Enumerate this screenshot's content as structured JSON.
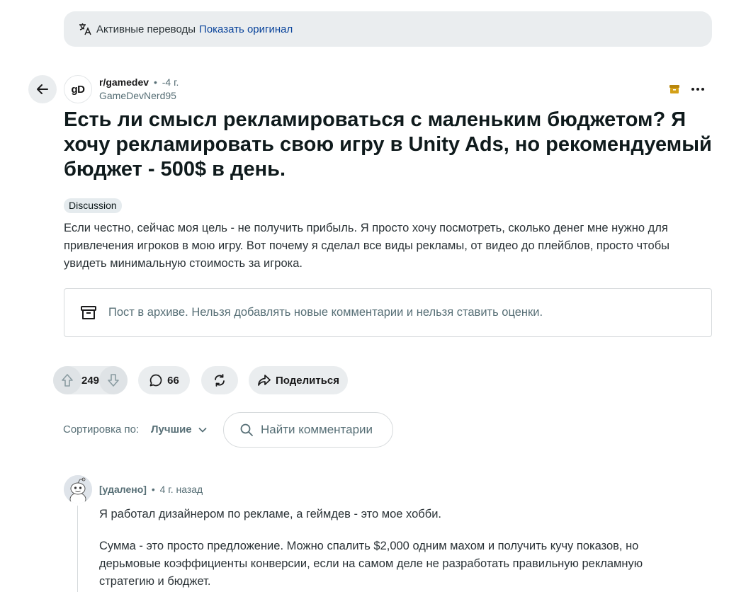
{
  "banner": {
    "text": "Активные переводы",
    "link": "Показать оригинал"
  },
  "post": {
    "subreddit": "r/gamedev",
    "separator": "•",
    "time": "-4 г.",
    "author": "GameDevNerd95",
    "avatar_text": "gD",
    "title": "Есть ли смысл рекламироваться с маленьким бюджетом? Я хочу рекламировать свою игру в Unity Ads, но рекомендуемый бюджет - 500$ в день.",
    "flair": "Discussion",
    "body": "Если честно, сейчас моя цель - не получить прибыль. Я просто хочу посмотреть, сколько денег мне нужно для привлечения игроков в мою игру. Вот почему я сделал все виды рекламы, от видео до плейблов, просто чтобы увидеть минимальную стоимость за игрока.",
    "archived_notice": "Пост в архиве. Нельзя добавлять новые комментарии и нельзя ставить оценки.",
    "votes": "249",
    "comments": "66",
    "share_label": "Поделиться",
    "archive_icon_color": "#b8860b"
  },
  "sort": {
    "label": "Сортировка по:",
    "value": "Лучшие"
  },
  "search": {
    "placeholder": "Найти комментарии"
  },
  "comment": {
    "author": "[удалено]",
    "separator": "•",
    "time": "4 г. назад",
    "paragraphs": [
      "Я работал дизайнером по рекламе, а геймдев - это мое хобби.",
      "Сумма - это просто предложение. Можно спалить $2,000 одним махом и получить кучу показов, но дерьмовые коэффициенты конверсии, если на самом деле не разработать правильную рекламную стратегию и бюджет."
    ]
  },
  "colors": {
    "link": "#0a449b",
    "banner_bg": "#eaedef",
    "muted_text": "#576f76"
  },
  "icons": [
    "translate-icon",
    "arrow-left-icon",
    "archive-icon",
    "ellipsis-icon",
    "upvote-icon",
    "downvote-icon",
    "comment-icon",
    "crosspost-icon",
    "share-icon",
    "chevron-down-icon",
    "search-icon",
    "snoo-avatar-icon"
  ]
}
